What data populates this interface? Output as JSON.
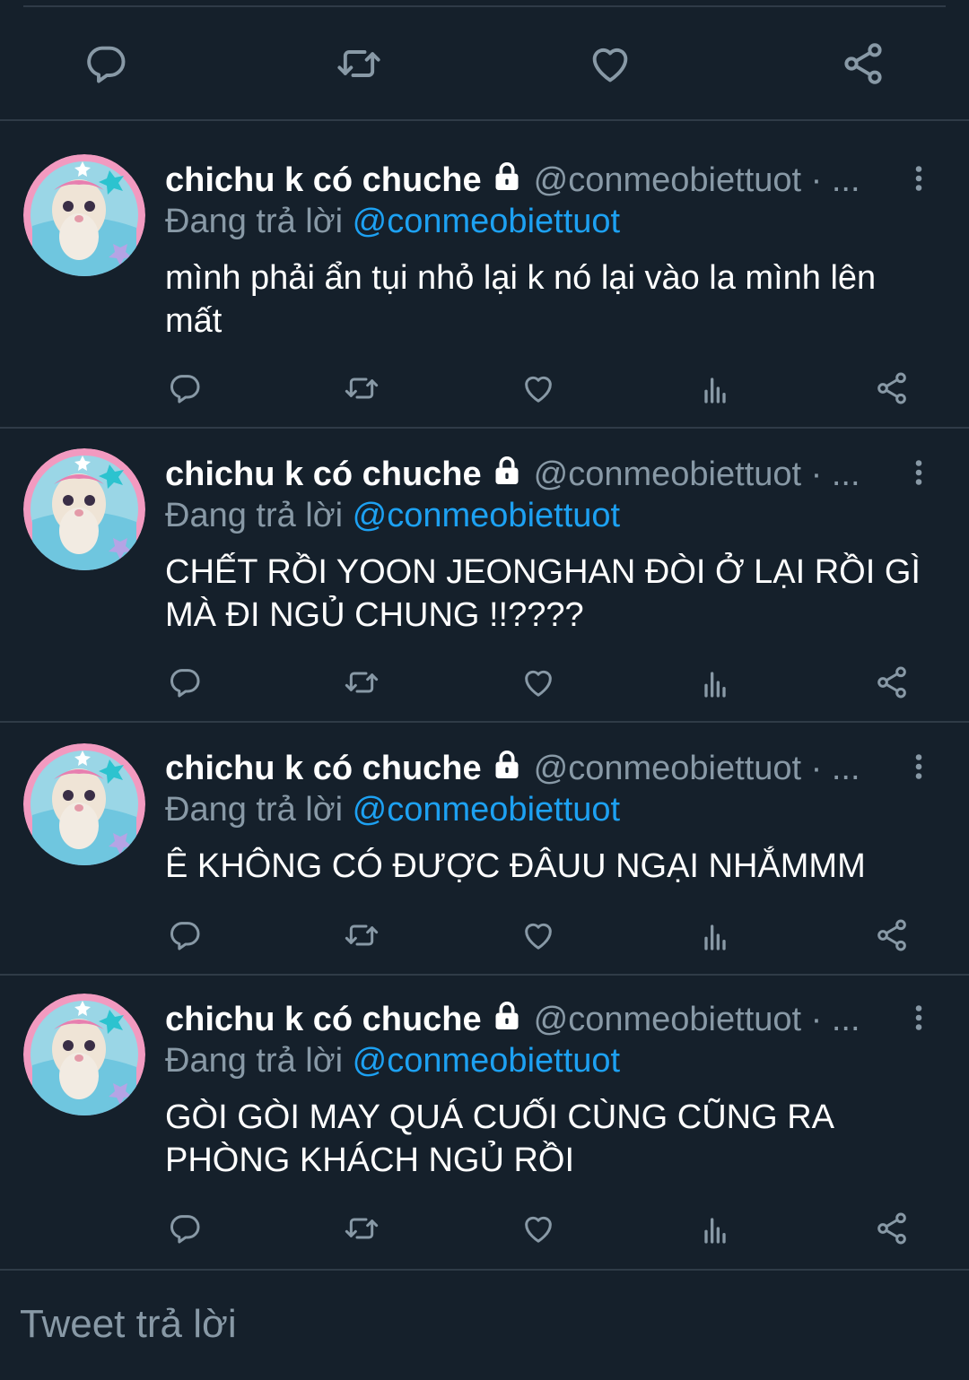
{
  "colors": {
    "background": "#15202b",
    "divider": "#2f3b47",
    "icon": "#8899a6",
    "accent": "#1da1f2",
    "text": "#ffffff",
    "secondary_text": "#8899a6"
  },
  "main_actions": {
    "icons": [
      "reply-icon",
      "retweet-icon",
      "like-icon",
      "share-icon"
    ]
  },
  "tweets": [
    {
      "name": "chichu k có chuche",
      "handle": "@conmeobiettuot · ...",
      "reply_prefix": "Đang trả lời",
      "reply_mention": "@conmeobiettuot",
      "text": "mình phải ẩn tụi nhỏ lại k nó lại vào la mình lên mất"
    },
    {
      "name": "chichu k có chuche",
      "handle": "@conmeobiettuot · ...",
      "reply_prefix": "Đang trả lời",
      "reply_mention": "@conmeobiettuot",
      "text": "CHẾT RỒI YOON JEONGHAN ĐÒI Ở LẠI RỒI GÌ MÀ ĐI NGỦ CHUNG !!????"
    },
    {
      "name": "chichu k có chuche",
      "handle": "@conmeobiettuot · ...",
      "reply_prefix": "Đang trả lời",
      "reply_mention": "@conmeobiettuot",
      "text": "Ê KHÔNG CÓ ĐƯỢC ĐÂUU NGẠI NHẮMMM"
    },
    {
      "name": "chichu k có chuche",
      "handle": "@conmeobiettuot · ...",
      "reply_prefix": "Đang trả lời",
      "reply_mention": "@conmeobiettuot",
      "text": "GÒI GÒI MAY QUÁ CUỐI CÙNG CŨNG RA PHÒNG KHÁCH NGỦ RỒI"
    }
  ],
  "tweet_action_icons": [
    "reply-icon",
    "retweet-icon",
    "like-icon",
    "analytics-icon",
    "share-icon"
  ],
  "composer": {
    "placeholder": "Tweet trả lời"
  }
}
